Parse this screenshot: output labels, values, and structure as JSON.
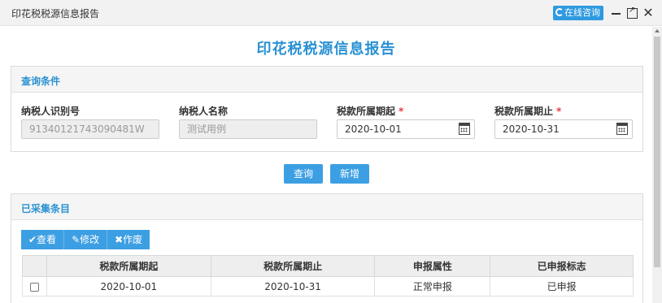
{
  "window": {
    "title": "印花税税源信息报告",
    "consult_label": "在线咨询",
    "close_glyph": "✕"
  },
  "page": {
    "title": "印花税税源信息报告"
  },
  "query_panel": {
    "title": "查询条件",
    "fields": [
      {
        "label": "纳税人识别号",
        "value": "91340121743090481W",
        "required": false,
        "disabled": true
      },
      {
        "label": "纳税人名称",
        "value": "测试用例",
        "required": false,
        "disabled": true
      },
      {
        "label": "税款所属期起",
        "value": "2020-10-01",
        "required": true,
        "disabled": false
      },
      {
        "label": "税款所属期止",
        "value": "2020-10-31",
        "required": true,
        "disabled": false
      }
    ],
    "required_mark": "*"
  },
  "actions": {
    "query_label": "查询",
    "add_label": "新增"
  },
  "collected_panel": {
    "title": "已采集条目",
    "toolbar": {
      "view_label": "✔查看",
      "edit_label": "✎修改",
      "void_label": "✖作废"
    },
    "columns": [
      "",
      "税款所属期起",
      "税款所属期止",
      "申报属性",
      "已申报标志"
    ],
    "rows": [
      {
        "start": "2020-10-01",
        "end": "2020-10-31",
        "attr": "正常申报",
        "flag": "已申报"
      }
    ]
  },
  "colors": {
    "accent": "#2a91d2",
    "button": "#3d9fe3",
    "required": "#e23c3c"
  }
}
